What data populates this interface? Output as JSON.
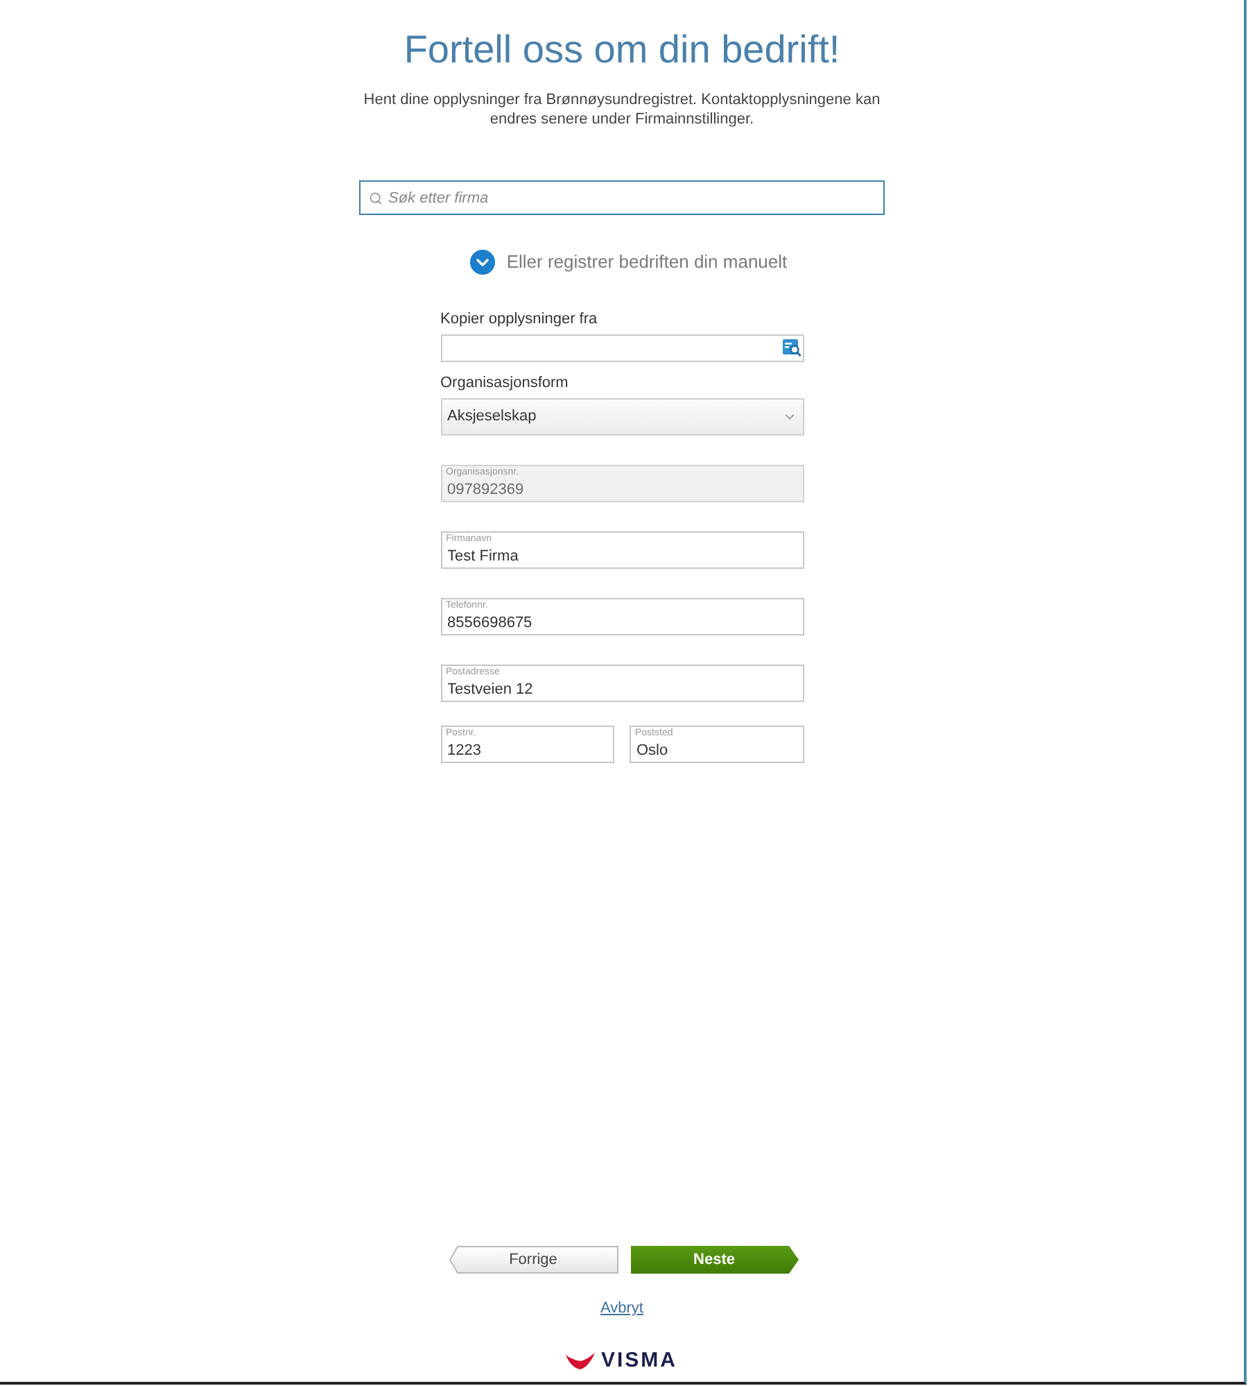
{
  "header": {
    "title": "Fortell oss om din bedrift!",
    "subtitle": "Hent dine opplysninger fra Brønnøysundregistret. Kontaktopplysningene kan endres senere under Firmainnstillinger."
  },
  "search": {
    "placeholder": "Søk etter firma"
  },
  "manual_toggle": {
    "label": "Eller registrer bedriften din manuelt",
    "expanded": true
  },
  "form": {
    "rows": [
      {
        "fields": [
          {
            "kind": "lookup",
            "label": "Kopier opplysninger fra"
          }
        ]
      },
      {
        "fields": [
          {
            "kind": "select",
            "label": "Organisasjonsform",
            "value": "Aksjeselskap"
          }
        ]
      },
      {
        "fields": [
          {
            "kind": "floating",
            "label": "Organisasjonsnr.",
            "value": "097892369",
            "disabled": true
          }
        ]
      },
      {
        "fields": [
          {
            "kind": "floating",
            "label": "Firmanavn",
            "value": "Test Firma",
            "disabled": false
          }
        ]
      },
      {
        "fields": [
          {
            "kind": "floating",
            "label": "Telefonnr.",
            "value": "8556698675",
            "disabled": false
          }
        ]
      },
      {
        "fields": [
          {
            "kind": "floating",
            "label": "Postadresse",
            "value": "Testveien 12",
            "disabled": false
          }
        ]
      },
      {
        "fields": [
          {
            "kind": "floating",
            "label": "Postnr.",
            "value": "1223",
            "disabled": false
          },
          {
            "kind": "floating",
            "label": "Poststed",
            "value": "Oslo",
            "disabled": false
          }
        ]
      }
    ]
  },
  "nav_buttons": [
    {
      "kind": "back",
      "label": "Forrige"
    },
    {
      "kind": "next",
      "label": "Neste"
    }
  ],
  "cancel_link": "Avbryt",
  "logo": {
    "text": "VISMA"
  }
}
